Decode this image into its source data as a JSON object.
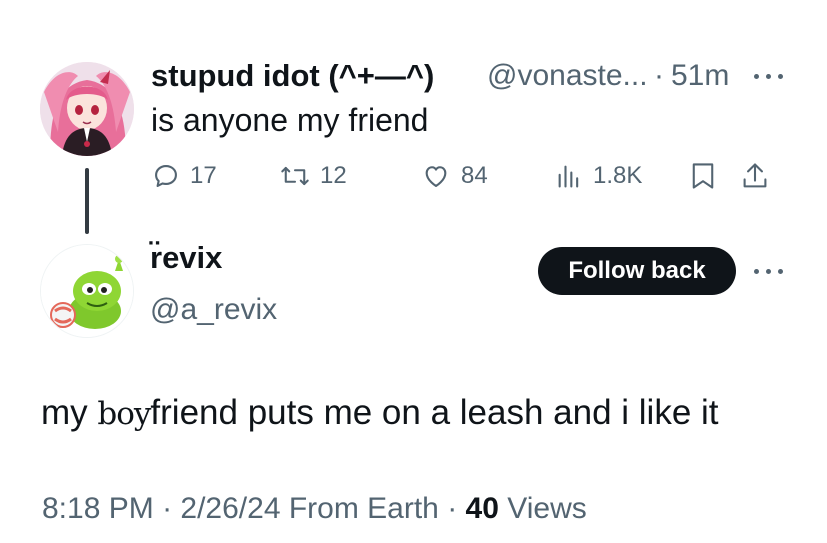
{
  "parent_tweet": {
    "display_name": "stupud idot  (^+—^)",
    "handle": "@vonaste...",
    "separator": "·",
    "time_ago": "51m",
    "text": "is anyone my friend",
    "actions": {
      "replies": "17",
      "reposts": "12",
      "likes": "84",
      "views": "1.8K"
    }
  },
  "reply_tweet": {
    "display_name": "r̈evix",
    "handle": "@a_revix",
    "follow_label": "Follow back",
    "text_parts": [
      "my ",
      "boy",
      "friend puts me on a leash and i like it"
    ],
    "meta": {
      "time": "8:18 PM",
      "sep1": " · ",
      "date": "2/26/24",
      "source": " From Earth",
      "sep2": " · ",
      "views_count": "40",
      "views_label": " Views"
    }
  },
  "icons": {
    "reply": "speech-bubble-icon",
    "repost": "repost-arrows-icon",
    "like": "heart-icon",
    "views": "bar-chart-icon",
    "bookmark": "bookmark-icon",
    "share": "share-upload-icon",
    "more": "more-dots-icon"
  },
  "colors": {
    "text_primary": "#0f1419",
    "text_secondary": "#536471",
    "button_bg": "#0f1419",
    "button_text": "#ffffff",
    "thread_line": "#333b42"
  }
}
